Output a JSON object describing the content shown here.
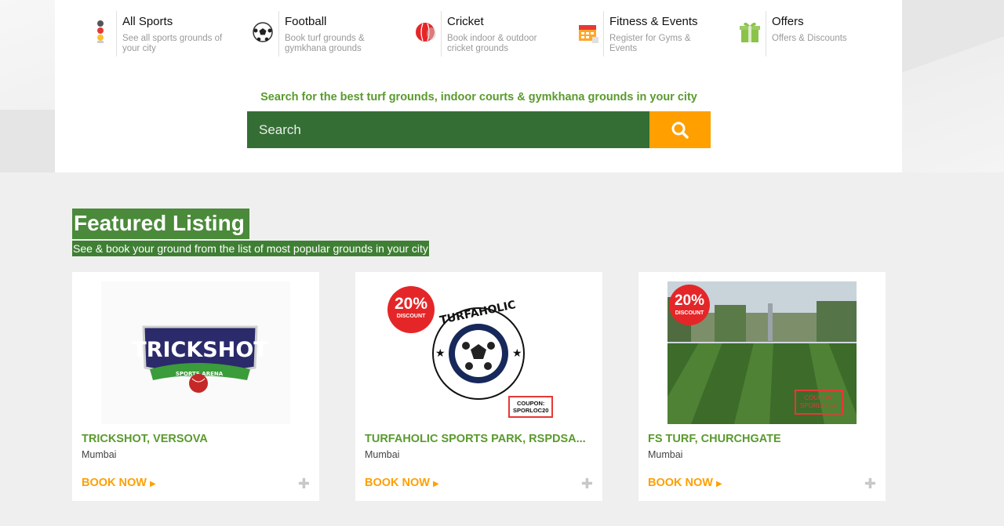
{
  "categories": [
    {
      "title": "All Sports",
      "desc": "See all sports grounds of your city",
      "icon": "traffic-light-icon"
    },
    {
      "title": "Football",
      "desc": "Book turf grounds & gymkhana grounds",
      "icon": "football-icon"
    },
    {
      "title": "Cricket",
      "desc": "Book indoor & outdoor cricket grounds",
      "icon": "cricket-ball-icon"
    },
    {
      "title": "Fitness & Events",
      "desc": "Register for Gyms & Events",
      "icon": "calendar-icon"
    },
    {
      "title": "Offers",
      "desc": "Offers & Discounts",
      "icon": "gift-icon"
    }
  ],
  "search": {
    "caption": "Search for the best turf grounds, indoor courts & gymkhana grounds in your city",
    "placeholder": "Search",
    "button_icon": "search-icon"
  },
  "featured": {
    "title": "Featured Listing",
    "subtitle": "See & book your ground from the list of most popular grounds in your city"
  },
  "listings": [
    {
      "name": "TRICKSHOT, VERSOVA",
      "city": "Mumbai",
      "book": "BOOK NOW",
      "logo_text": "TRICKSHOT",
      "logo_sub": "SPORTS ARENA"
    },
    {
      "name": "TURFAHOLIC SPORTS PARK, RSPDSA...",
      "city": "Mumbai",
      "book": "BOOK NOW",
      "logo_text": "TURFAHOLIC",
      "badge_pct": "20%",
      "badge_text": "DISCOUNT",
      "coupon_label": "COUPON:",
      "coupon_code": "SPORLOC20"
    },
    {
      "name": "FS TURF, CHURCHGATE",
      "city": "Mumbai",
      "book": "BOOK NOW",
      "badge_pct": "20%",
      "badge_text": "DISCOUNT",
      "coupon_label": "COUPON:",
      "coupon_code": "SPORLOC20"
    }
  ],
  "colors": {
    "green": "#356e35",
    "accent": "#ff9f00",
    "title_green": "#5a9a2e"
  }
}
